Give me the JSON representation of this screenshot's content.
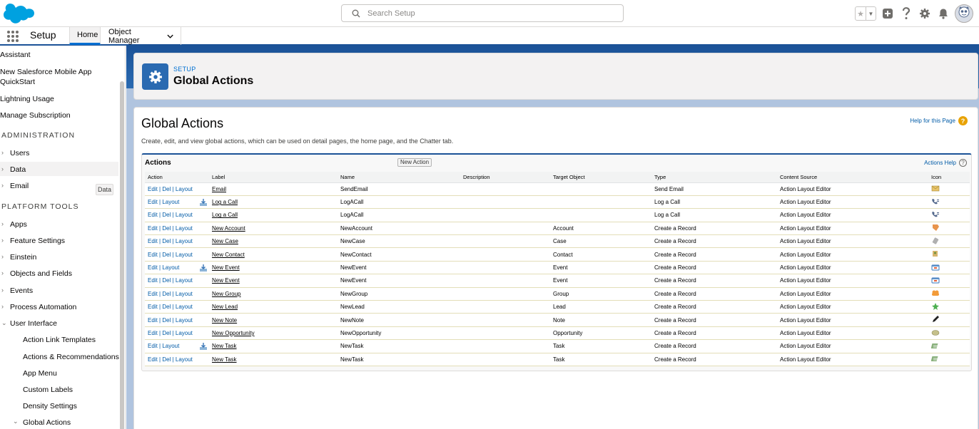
{
  "header": {
    "search_placeholder": "Search Setup",
    "icons": [
      "salesforce-logo",
      "star-icon",
      "chevron-down-icon",
      "plus-icon",
      "help-icon",
      "gear-icon",
      "bell-icon",
      "avatar"
    ]
  },
  "context": {
    "app_name": "Setup",
    "tabs": [
      {
        "label": "Home",
        "active": true
      },
      {
        "label": "Object Manager",
        "active": false
      }
    ]
  },
  "sidebar": {
    "partial_top": "Assistant",
    "mobile_1": "New Salesforce Mobile App",
    "mobile_2": "QuickStart",
    "lightning_usage": "Lightning Usage",
    "manage_subscription": "Manage Subscription",
    "admin_heading": "ADMINISTRATION",
    "users": "Users",
    "data": "Data",
    "email": "Email",
    "tooltip": "Data",
    "platform_heading": "PLATFORM TOOLS",
    "apps": "Apps",
    "feature_settings": "Feature Settings",
    "einstein": "Einstein",
    "objects_fields": "Objects and Fields",
    "events": "Events",
    "process_automation": "Process Automation",
    "user_interface": "User Interface",
    "action_link_templates": "Action Link Templates",
    "actions_recommendations": "Actions & Recommendations",
    "app_menu": "App Menu",
    "custom_labels": "Custom Labels",
    "density_settings": "Density Settings",
    "global_actions": "Global Actions"
  },
  "page_header": {
    "eyebrow": "SETUP",
    "title": "Global Actions"
  },
  "content": {
    "heading": "Global Actions",
    "description": "Create, edit, and view global actions, which can be used on detail pages, the home page, and the Chatter tab.",
    "help_link": "Help for this Page"
  },
  "panel": {
    "title": "Actions",
    "new_button": "New Action",
    "help_link": "Actions Help",
    "columns": [
      "Action",
      "Label",
      "Name",
      "Description",
      "Target Object",
      "Type",
      "Content Source",
      "Icon"
    ],
    "edit": "Edit",
    "del": "Del",
    "layout": "Layout",
    "rows": [
      {
        "has_del": true,
        "has_dl": false,
        "label": "Email",
        "name": "SendEmail",
        "description": "",
        "target": "",
        "type": "Send Email",
        "source": "Action Layout Editor",
        "icon": "email-icon",
        "icon_color": "#e9c46a"
      },
      {
        "has_del": false,
        "has_dl": true,
        "label": "Log a Call",
        "name": "LogACall",
        "description": "",
        "target": "",
        "type": "Log a Call",
        "source": "Action Layout Editor",
        "icon": "phone-icon",
        "icon_color": "#54698d"
      },
      {
        "has_del": true,
        "has_dl": false,
        "label": "Log a Call",
        "name": "LogACall",
        "description": "",
        "target": "",
        "type": "Log a Call",
        "source": "Action Layout Editor",
        "icon": "phone-icon",
        "icon_color": "#54698d"
      },
      {
        "has_del": true,
        "has_dl": false,
        "label": "New Account",
        "name": "NewAccount",
        "description": "",
        "target": "Account",
        "type": "Create a Record",
        "source": "Action Layout Editor",
        "icon": "account-icon",
        "icon_color": "#e8944b"
      },
      {
        "has_del": true,
        "has_dl": false,
        "label": "New Case",
        "name": "NewCase",
        "description": "",
        "target": "Case",
        "type": "Create a Record",
        "source": "Action Layout Editor",
        "icon": "case-icon",
        "icon_color": "#b0b0b0"
      },
      {
        "has_del": true,
        "has_dl": false,
        "label": "New Contact",
        "name": "NewContact",
        "description": "",
        "target": "Contact",
        "type": "Create a Record",
        "source": "Action Layout Editor",
        "icon": "contact-icon",
        "icon_color": "#d7b56d"
      },
      {
        "has_del": false,
        "has_dl": true,
        "label": "New Event",
        "name": "NewEvent",
        "description": "",
        "target": "Event",
        "type": "Create a Record",
        "source": "Action Layout Editor",
        "icon": "event-icon",
        "icon_color": "#5b8fc7"
      },
      {
        "has_del": true,
        "has_dl": false,
        "label": "New Event",
        "name": "NewEvent",
        "description": "",
        "target": "Event",
        "type": "Create a Record",
        "source": "Action Layout Editor",
        "icon": "event-icon",
        "icon_color": "#5b8fc7"
      },
      {
        "has_del": true,
        "has_dl": false,
        "label": "New Group",
        "name": "NewGroup",
        "description": "",
        "target": "Group",
        "type": "Create a Record",
        "source": "Action Layout Editor",
        "icon": "group-icon",
        "icon_color": "#f29b38"
      },
      {
        "has_del": true,
        "has_dl": false,
        "label": "New Lead",
        "name": "NewLead",
        "description": "",
        "target": "Lead",
        "type": "Create a Record",
        "source": "Action Layout Editor",
        "icon": "lead-icon",
        "icon_color": "#4caf50"
      },
      {
        "has_del": true,
        "has_dl": false,
        "label": "New Note",
        "name": "NewNote",
        "description": "",
        "target": "Note",
        "type": "Create a Record",
        "source": "Action Layout Editor",
        "icon": "note-icon",
        "icon_color": "#222222"
      },
      {
        "has_del": true,
        "has_dl": false,
        "label": "New Opportunity",
        "name": "NewOpportunity",
        "description": "",
        "target": "Opportunity",
        "type": "Create a Record",
        "source": "Action Layout Editor",
        "icon": "opportunity-icon",
        "icon_color": "#c5c08a"
      },
      {
        "has_del": false,
        "has_dl": true,
        "label": "New Task",
        "name": "NewTask",
        "description": "",
        "target": "Task",
        "type": "Create a Record",
        "source": "Action Layout Editor",
        "icon": "task-icon",
        "icon_color": "#8ab17d"
      },
      {
        "has_del": true,
        "has_dl": false,
        "label": "New Task",
        "name": "NewTask",
        "description": "",
        "target": "Task",
        "type": "Create a Record",
        "source": "Action Layout Editor",
        "icon": "task-icon",
        "icon_color": "#8ab17d"
      }
    ]
  },
  "colors": {
    "brand_blue": "#1b5297",
    "link_blue": "#015ba7",
    "accent": "#0070d2",
    "help_orange": "#e8a202"
  }
}
